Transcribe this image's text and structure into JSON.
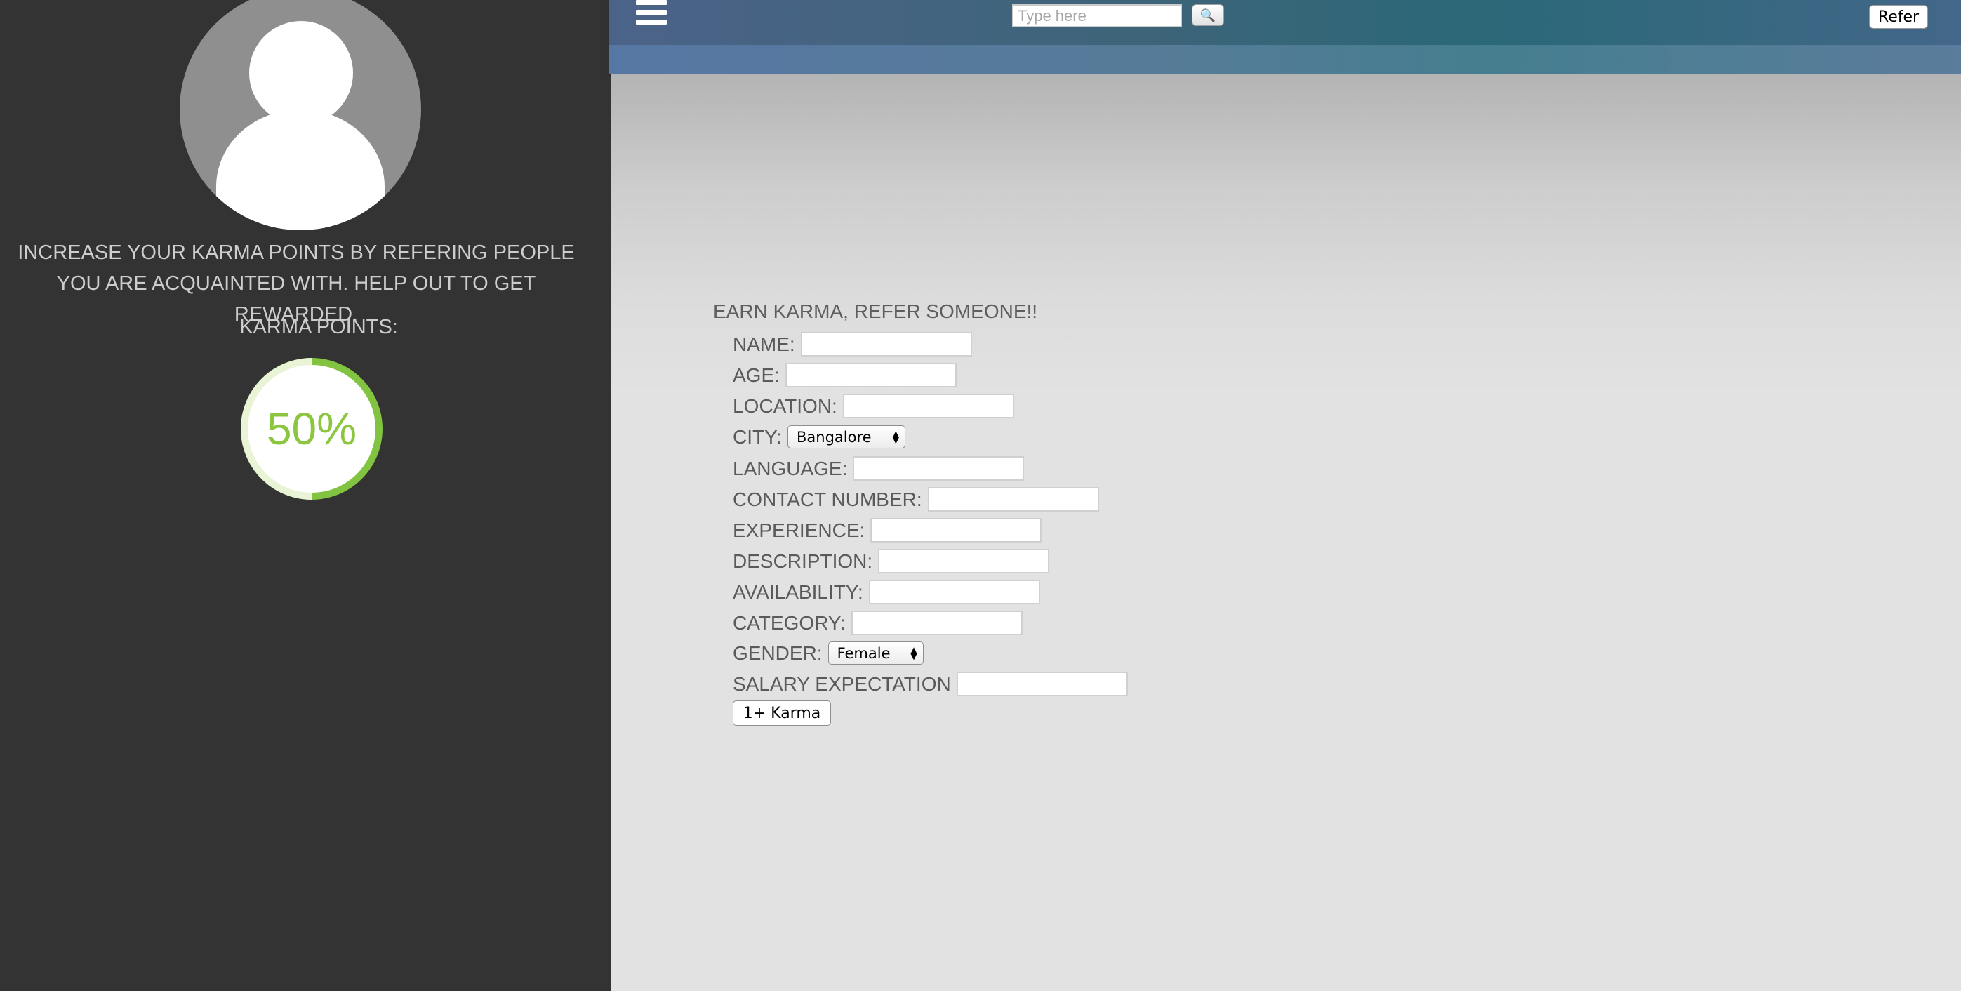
{
  "sidebar": {
    "promo_text": "INCREASE YOUR KARMA POINTS BY REFERING PEOPLE YOU ARE ACQUAINTED WITH. HELP OUT TO GET REWARDED.",
    "karma_label": "KARMA POINTS:",
    "karma_percent": "50%",
    "karma_progress": 0.5
  },
  "topbar": {
    "search_placeholder": "Type here",
    "search_icon": "search-icon",
    "refer_label": "Refer",
    "menu_icon": "hamburger-menu-icon"
  },
  "form": {
    "title": "EARN KARMA, REFER SOMEONE!!",
    "fields": {
      "name": "NAME:",
      "age": "AGE:",
      "location": "LOCATION:",
      "city": "CITY:",
      "language": "LANGUAGE:",
      "contact": "CONTACT NUMBER:",
      "experience": "EXPERIENCE:",
      "description": "DESCRIPTION:",
      "availability": "AVAILABILITY:",
      "category": "CATEGORY:",
      "gender": "GENDER:",
      "salary": "SALARY EXPECTATION"
    },
    "city_value": "Bangalore",
    "gender_value": "Female",
    "submit_label": "1+ Karma"
  },
  "colors": {
    "sidebar_bg": "#333333",
    "accent_green": "#8cc63f",
    "topbar_teal": "#2a6878"
  }
}
